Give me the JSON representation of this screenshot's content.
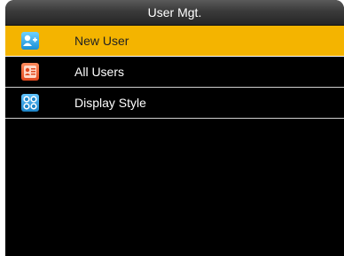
{
  "header": {
    "title": "User Mgt."
  },
  "menu": {
    "items": [
      {
        "label": "New User",
        "icon": "add-user-icon",
        "selected": true
      },
      {
        "label": "All Users",
        "icon": "user-list-icon",
        "selected": false
      },
      {
        "label": "Display Style",
        "icon": "display-style-icon",
        "selected": false
      }
    ]
  },
  "colors": {
    "selected_bg": "#f4b400",
    "screen_bg": "#000000",
    "row_divider": "#cfcfcf"
  }
}
